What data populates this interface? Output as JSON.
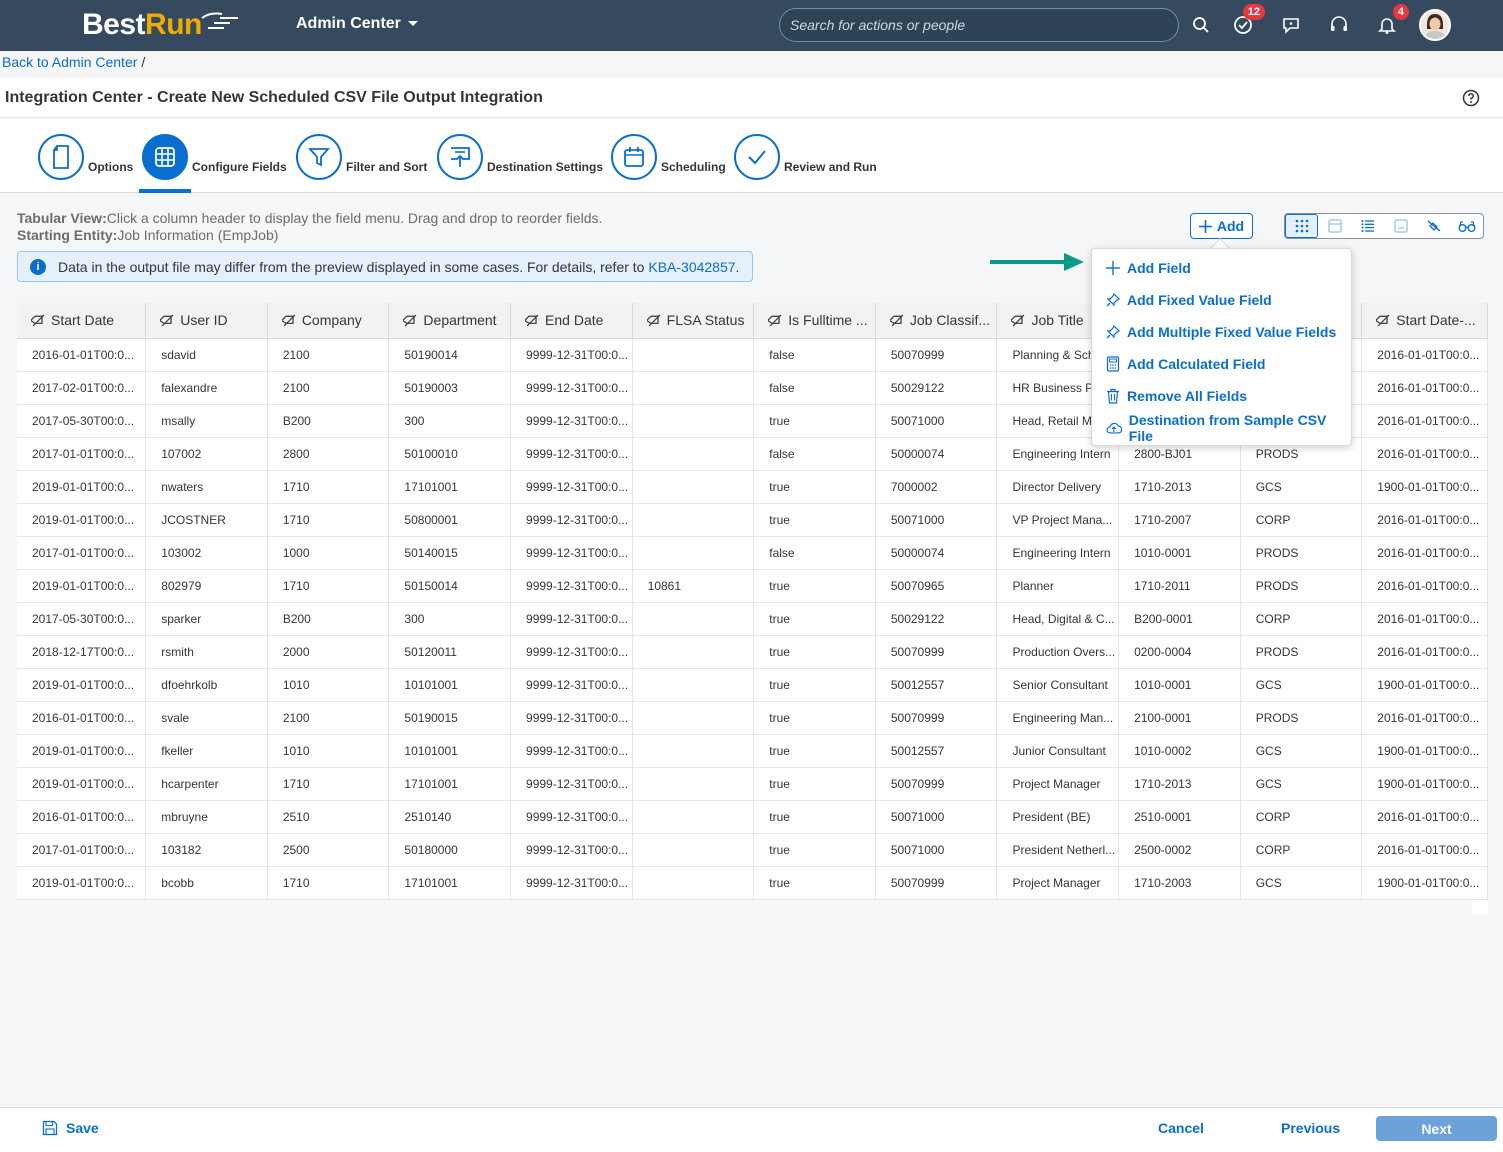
{
  "shell": {
    "logo_part1": "Best",
    "logo_part2": "Run",
    "app_menu": "Admin Center",
    "search_placeholder": "Search for actions or people",
    "todo_badge": "12",
    "notifications_badge": "4"
  },
  "breadcrumb": {
    "back_link": "Back to Admin Center",
    "separator": "/"
  },
  "page": {
    "title": "Integration Center - Create New Scheduled CSV File Output Integration"
  },
  "wizard": {
    "steps": [
      {
        "label": "Options",
        "icon": "document-icon"
      },
      {
        "label": "Configure Fields",
        "icon": "grid-icon"
      },
      {
        "label": "Filter and Sort",
        "icon": "filter-icon"
      },
      {
        "label": "Destination Settings",
        "icon": "upload-icon"
      },
      {
        "label": "Scheduling",
        "icon": "calendar-icon"
      },
      {
        "label": "Review and Run",
        "icon": "checkmark-icon"
      }
    ],
    "active_step": 1
  },
  "info": {
    "tabular_label": "Tabular View:",
    "tabular_text": "Click a column header to display the field menu. Drag and drop to reorder fields.",
    "entity_label": "Starting Entity:",
    "entity_text": "Job Information (EmpJob)",
    "message_text": "Data in the output file may differ from the preview displayed in some cases. For details, refer to",
    "message_link": "KBA-3042857",
    "message_end": "."
  },
  "toolbar": {
    "add_label": "Add"
  },
  "add_menu": {
    "items": [
      {
        "label": "Add Field",
        "icon": "plus-icon"
      },
      {
        "label": "Add Fixed Value Field",
        "icon": "pin-icon"
      },
      {
        "label": "Add Multiple Fixed Value Fields",
        "icon": "pin-icon"
      },
      {
        "label": "Add Calculated Field",
        "icon": "calculator-icon"
      },
      {
        "label": "Remove All Fields",
        "icon": "trash-icon"
      },
      {
        "label": "Destination from Sample CSV File",
        "icon": "cloud-icon"
      }
    ]
  },
  "table": {
    "columns": [
      "Start Date",
      "User ID",
      "Company",
      "Department",
      "End Date",
      "FLSA Status",
      "Is Fulltime ...",
      "Job Classif...",
      "Job Title",
      "",
      "",
      "Start Date-..."
    ],
    "rows": [
      [
        "2016-01-01T00:0...",
        "sdavid",
        "2100",
        "50190014",
        "9999-12-31T00:0...",
        "",
        "false",
        "50070999",
        "Planning & Sche...",
        "",
        "",
        "2016-01-01T00:0..."
      ],
      [
        "2017-02-01T00:0...",
        "falexandre",
        "2100",
        "50190003",
        "9999-12-31T00:0...",
        "",
        "false",
        "50029122",
        "HR Business Part...",
        "",
        "",
        "2016-01-01T00:0..."
      ],
      [
        "2017-05-30T00:0...",
        "msally",
        "B200",
        "300",
        "9999-12-31T00:0...",
        "",
        "true",
        "50071000",
        "Head, Retail Mar...",
        "",
        "",
        "2016-01-01T00:0..."
      ],
      [
        "2017-01-01T00:0...",
        "107002",
        "2800",
        "50100010",
        "9999-12-31T00:0...",
        "",
        "false",
        "50000074",
        "Engineering Intern",
        "2800-BJ01",
        "PRODS",
        "2016-01-01T00:0..."
      ],
      [
        "2019-01-01T00:0...",
        "nwaters",
        "1710",
        "17101001",
        "9999-12-31T00:0...",
        "",
        "true",
        "7000002",
        "Director Delivery",
        "1710-2013",
        "GCS",
        "1900-01-01T00:0..."
      ],
      [
        "2019-01-01T00:0...",
        "JCOSTNER",
        "1710",
        "50800001",
        "9999-12-31T00:0...",
        "",
        "true",
        "50071000",
        "VP Project Mana...",
        "1710-2007",
        "CORP",
        "2016-01-01T00:0..."
      ],
      [
        "2017-01-01T00:0...",
        "103002",
        "1000",
        "50140015",
        "9999-12-31T00:0...",
        "",
        "false",
        "50000074",
        "Engineering Intern",
        "1010-0001",
        "PRODS",
        "2016-01-01T00:0..."
      ],
      [
        "2019-01-01T00:0...",
        "802979",
        "1710",
        "50150014",
        "9999-12-31T00:0...",
        "10861",
        "true",
        "50070965",
        "Planner",
        "1710-2011",
        "PRODS",
        "2016-01-01T00:0..."
      ],
      [
        "2017-05-30T00:0...",
        "sparker",
        "B200",
        "300",
        "9999-12-31T00:0...",
        "",
        "true",
        "50029122",
        "Head, Digital & C...",
        "B200-0001",
        "CORP",
        "2016-01-01T00:0..."
      ],
      [
        "2018-12-17T00:0...",
        "rsmith",
        "2000",
        "50120011",
        "9999-12-31T00:0...",
        "",
        "true",
        "50070999",
        "Production Overs...",
        "0200-0004",
        "PRODS",
        "2016-01-01T00:0..."
      ],
      [
        "2019-01-01T00:0...",
        "dfoehrkolb",
        "1010",
        "10101001",
        "9999-12-31T00:0...",
        "",
        "true",
        "50012557",
        "Senior Consultant",
        "1010-0001",
        "GCS",
        "1900-01-01T00:0..."
      ],
      [
        "2016-01-01T00:0...",
        "svale",
        "2100",
        "50190015",
        "9999-12-31T00:0...",
        "",
        "true",
        "50070999",
        "Engineering Man...",
        "2100-0001",
        "PRODS",
        "2016-01-01T00:0..."
      ],
      [
        "2019-01-01T00:0...",
        "fkeller",
        "1010",
        "10101001",
        "9999-12-31T00:0...",
        "",
        "true",
        "50012557",
        "Junior Consultant",
        "1010-0002",
        "GCS",
        "1900-01-01T00:0..."
      ],
      [
        "2019-01-01T00:0...",
        "hcarpenter",
        "1710",
        "17101001",
        "9999-12-31T00:0...",
        "",
        "true",
        "50070999",
        "Project Manager",
        "1710-2013",
        "GCS",
        "1900-01-01T00:0..."
      ],
      [
        "2016-01-01T00:0...",
        "mbruyne",
        "2510",
        "2510140",
        "9999-12-31T00:0...",
        "",
        "true",
        "50071000",
        "President (BE)",
        "2510-0001",
        "CORP",
        "2016-01-01T00:0..."
      ],
      [
        "2017-01-01T00:0...",
        "103182",
        "2500",
        "50180000",
        "9999-12-31T00:0...",
        "",
        "true",
        "50071000",
        "President Netherl...",
        "2500-0002",
        "CORP",
        "2016-01-01T00:0..."
      ],
      [
        "2019-01-01T00:0...",
        "bcobb",
        "1710",
        "17101001",
        "9999-12-31T00:0...",
        "",
        "true",
        "50070999",
        "Project Manager",
        "1710-2003",
        "GCS",
        "1900-01-01T00:0..."
      ]
    ]
  },
  "footer": {
    "save": "Save",
    "cancel": "Cancel",
    "previous": "Previous",
    "next": "Next"
  },
  "colors": {
    "shell": "#354a5f",
    "accent": "#0a6ed1",
    "logo_run": "#f0ab00",
    "arrow": "#0a9a8a",
    "badge": "#e9373f"
  }
}
